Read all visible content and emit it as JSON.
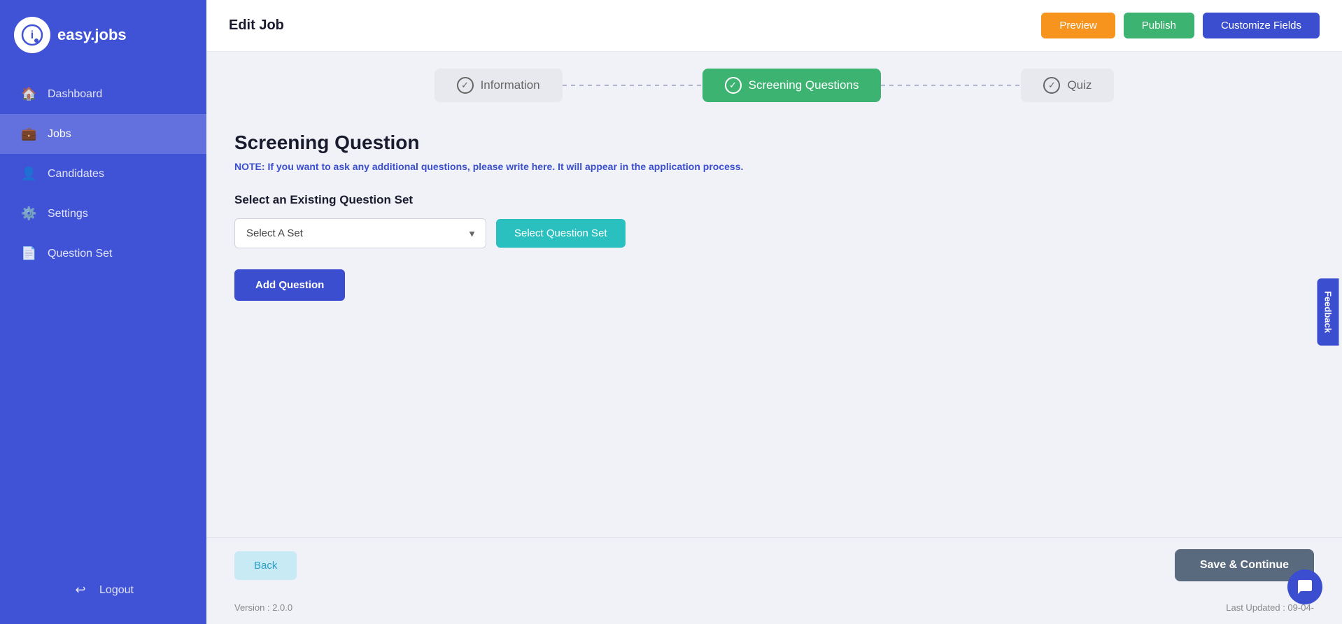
{
  "app": {
    "name": "easy.jobs",
    "logo_letter": "i"
  },
  "sidebar": {
    "items": [
      {
        "id": "dashboard",
        "label": "Dashboard",
        "icon": "🏠"
      },
      {
        "id": "jobs",
        "label": "Jobs",
        "icon": "💼"
      },
      {
        "id": "candidates",
        "label": "Candidates",
        "icon": "👤"
      },
      {
        "id": "settings",
        "label": "Settings",
        "icon": "⚙️"
      },
      {
        "id": "question-set",
        "label": "Question Set",
        "icon": "📄"
      }
    ],
    "logout": {
      "label": "Logout",
      "icon": "↩"
    }
  },
  "header": {
    "title": "Edit Job",
    "actions": {
      "preview_label": "Preview",
      "publish_label": "Publish",
      "customize_label": "Customize Fields"
    }
  },
  "steps": [
    {
      "id": "information",
      "label": "Information",
      "active": false
    },
    {
      "id": "screening",
      "label": "Screening Questions",
      "active": true
    },
    {
      "id": "quiz",
      "label": "Quiz",
      "active": false
    }
  ],
  "content": {
    "title": "Screening Question",
    "note_prefix": "NOTE:",
    "note_text": "If you want to ask any additional questions, please write here. It will appear in the application process.",
    "existing_set_label": "Select an Existing Question Set",
    "select_placeholder": "Select A Set",
    "select_question_set_btn": "Select Question Set",
    "add_question_btn": "Add Question",
    "back_btn": "Back",
    "save_continue_btn": "Save & Continue"
  },
  "footer": {
    "version": "Version : 2.0.0",
    "last_updated": "Last Updated : 09-04-"
  },
  "feedback": {
    "label": "Feedback"
  }
}
